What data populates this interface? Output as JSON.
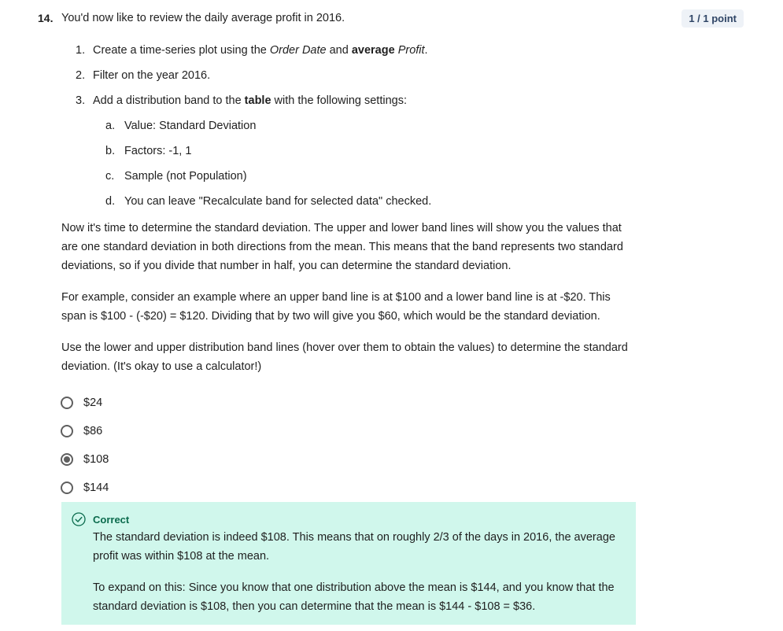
{
  "question": {
    "number": "14.",
    "title": "You'd now like to review the daily average profit in 2016.",
    "points": "1 / 1 point"
  },
  "steps": [
    {
      "num": "1.",
      "pre": "Create a time-series plot using the ",
      "em1": "Order Date",
      "mid": " and ",
      "strong": "average",
      "space": " ",
      "em2": "Profit",
      "post": "."
    },
    {
      "num": "2.",
      "text": "Filter on the year 2016."
    },
    {
      "num": "3.",
      "pre": "Add a distribution band to the ",
      "strong": "table",
      "post": " with the following settings:"
    }
  ],
  "substeps": [
    {
      "num": "a.",
      "text": "Value: Standard Deviation"
    },
    {
      "num": "b.",
      "text": "Factors: -1, 1"
    },
    {
      "num": "c.",
      "text": "Sample (not Population)"
    },
    {
      "num": "d.",
      "text": "You can leave \"Recalculate band for selected data\" checked."
    }
  ],
  "paragraphs": [
    "Now it's time to determine the standard deviation. The upper and lower band lines will show you the values that are one standard deviation in both directions from the mean. This means that the band represents two standard deviations, so if you divide that number in half, you can determine the standard deviation.",
    "For example, consider an example where an upper band line is at $100 and a lower band line is at -$20. This span is $100 - (-$20) = $120. Dividing that by two will give you $60, which would be the standard deviation.",
    "Use the lower and upper distribution band lines (hover over them to obtain the values) to determine the standard deviation. (It's okay to use a calculator!)"
  ],
  "options": [
    {
      "label": "$24",
      "selected": false
    },
    {
      "label": "$86",
      "selected": false
    },
    {
      "label": "$108",
      "selected": true
    },
    {
      "label": "$144",
      "selected": false
    }
  ],
  "feedback": {
    "status": "Correct",
    "icon": "check-circle-icon",
    "text1": "The standard deviation is indeed $108. This means that on roughly 2/3 of the days in 2016, the average profit was within $108 at the mean.",
    "text2": "To expand on this: Since you know that one distribution above the mean is $144, and you know that the standard deviation is $108, then you can determine that the mean is $144 - $108 = $36."
  },
  "colors": {
    "feedback_bg": "#d0f7ec",
    "correct_green": "#0b6b4d",
    "points_bg": "#eef2f7"
  }
}
